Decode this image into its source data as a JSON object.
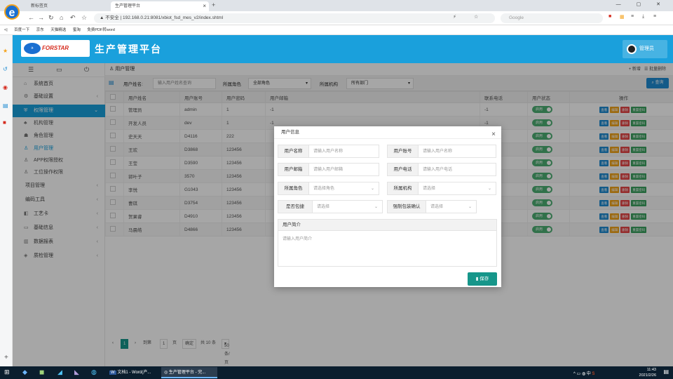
{
  "browser": {
    "tabs": [
      {
        "label": "新标签页"
      },
      {
        "label": "生产管理平台"
      }
    ],
    "url": "▲ 不安全 | 192.168.0.21:8081/xbiot_fsd_mes_v2/index.shtml",
    "search_placeholder": "Google",
    "bookmarks": [
      "百度一下",
      "京东",
      "天猫精选",
      "蜜淘",
      "免费PDF转word"
    ]
  },
  "header": {
    "brand": "FORSTAR",
    "title": "生产管理平台",
    "user": "管理员"
  },
  "sidebar": {
    "items": [
      {
        "label": "系统首页",
        "icon": "home-icon"
      },
      {
        "label": "基础设置",
        "icon": "gear-icon"
      },
      {
        "label": "权限管理",
        "icon": "shield-icon"
      },
      {
        "label": "机构管理",
        "icon": "org-icon"
      },
      {
        "label": "角色管理",
        "icon": "role-icon"
      },
      {
        "label": "用户管理",
        "icon": "user-icon"
      },
      {
        "label": "APP权限授权",
        "icon": "app-icon"
      },
      {
        "label": "工位操作权限",
        "icon": "station-icon"
      },
      {
        "label": "项目管理",
        "icon": ""
      },
      {
        "label": "编码工具",
        "icon": ""
      },
      {
        "label": "工艺卡",
        "icon": "card-icon"
      },
      {
        "label": "基础信息",
        "icon": "monitor-icon"
      },
      {
        "label": "数据报表",
        "icon": "report-icon"
      },
      {
        "label": "质检管理",
        "icon": "layers-icon"
      }
    ]
  },
  "main": {
    "breadcrumb": "用户管理",
    "actions": {
      "add": "+ 新增",
      "batch_delete": "☰ 批量删除"
    },
    "filters": {
      "name_label": "用户姓名:",
      "name_placeholder": "输入用户姓名查询",
      "role_label": "所属角色",
      "role_value": "全部角色",
      "org_label": "所属机构",
      "org_value": "所有部门",
      "query_button": "查询"
    },
    "table": {
      "headers": [
        "用户姓名",
        "用户账号",
        "用户密码",
        "用户邮箱",
        "联系电话",
        "用户状态",
        "操作"
      ],
      "rows": [
        {
          "name": "管理员",
          "account": "admin",
          "password": "1",
          "email": "-1",
          "phone": "-1",
          "status": "启用"
        },
        {
          "name": "开发人员",
          "account": "dev",
          "password": "1",
          "email": "-1",
          "phone": "-1",
          "status": "启用"
        },
        {
          "name": "史天天",
          "account": "D4116",
          "password": "222",
          "email": "",
          "phone": "",
          "status": "启用"
        },
        {
          "name": "王欢",
          "account": "D3868",
          "password": "123456",
          "email": "",
          "phone": "",
          "status": "启用"
        },
        {
          "name": "王莹",
          "account": "D3590",
          "password": "123456",
          "email": "",
          "phone": "",
          "status": "启用"
        },
        {
          "name": "郭叶子",
          "account": "3570",
          "password": "123456",
          "email": "",
          "phone": "",
          "status": "启用"
        },
        {
          "name": "李悦",
          "account": "G1043",
          "password": "123456",
          "email": "",
          "phone": "",
          "status": "启用"
        },
        {
          "name": "曹琪",
          "account": "D3754",
          "password": "123456",
          "email": "",
          "phone": "",
          "status": "启用"
        },
        {
          "name": "贺果睿",
          "account": "D4910",
          "password": "123456",
          "email": "",
          "phone": "",
          "status": "启用"
        },
        {
          "name": "马晨皓",
          "account": "D4866",
          "password": "123456",
          "email": "",
          "phone": "",
          "status": "启用"
        }
      ],
      "op_buttons": [
        "查看",
        "编辑",
        "删除",
        "重置密码"
      ]
    },
    "pager": {
      "current": "1",
      "goto_label": "到第",
      "goto_value": "1",
      "page_unit": "页",
      "confirm": "确定",
      "total": "共 10 条",
      "page_size": "50 条/页"
    }
  },
  "modal": {
    "title": "用户信息",
    "fields": [
      {
        "label": "用户名称",
        "placeholder": "请输入用户名称"
      },
      {
        "label": "用户账号",
        "placeholder": "请输入用户名称"
      },
      {
        "label": "用户邮箱",
        "placeholder": "请输入用户邮箱"
      },
      {
        "label": "用户电话",
        "placeholder": "请输入用户电话"
      },
      {
        "label": "所属角色",
        "placeholder": "请选择角色"
      },
      {
        "label": "所属机构",
        "placeholder": "请选择"
      },
      {
        "label": "是否包捷",
        "placeholder": "请选择"
      },
      {
        "label": "强制包装确认",
        "placeholder": "请选择"
      }
    ],
    "intro_label": "用户简介",
    "intro_placeholder": "请输入用户简介",
    "save": "保存"
  },
  "taskbar": {
    "apps": [
      "文档1 - Word(产...",
      "生产管理平台 - 完..."
    ],
    "time": "11:43",
    "date": "2021/2/26",
    "tray_text": "中"
  },
  "colors": {
    "accent": "#1aa0dc",
    "save": "#16968a",
    "enabled": "#4cae72"
  }
}
